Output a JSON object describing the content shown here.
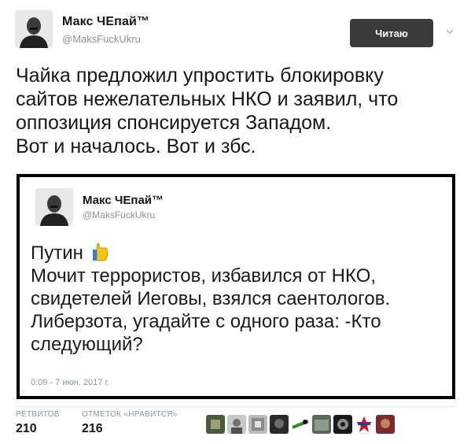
{
  "tweet": {
    "author_name": "Макс ЧЕпай™",
    "author_handle": "@MaksFuckUkru",
    "follow_button": "Читаю",
    "text_lines": [
      "Чайка предложил упростить блокировку",
      "сайтов нежелательных НКО и заявил, что",
      "оппозиция спонсируется Западом.",
      "Вот и началось. Вот и збс."
    ]
  },
  "quoted_tweet": {
    "author_name": "Макс ЧЕпай™",
    "author_handle": "@MaksFuckUkru",
    "text_first_line": "Путин",
    "text_lines": [
      "Мочит террористов, избавился от НКО,",
      "свидетелей Иеговы, взялся саентологов.",
      "Либерзота, угадайте с одного раза: -Кто",
      "следующий?"
    ],
    "timestamp": "0:09 - 7 июн. 2017 г."
  },
  "stats": {
    "retweets_label": "РЕТВИТОВ",
    "retweets_value": "210",
    "likes_label": "ОТМЕТОК «НРАВИТСЯ»",
    "likes_value": "216"
  },
  "icons": {
    "thumb": "thumbs-up-emoji",
    "caret": "chevron-down-icon"
  },
  "colors": {
    "follow_button_bg": "#3a3a3a",
    "quote_border": "#000000",
    "meta_text": "#8a949e",
    "thumb_yellow": "#f5c518"
  }
}
